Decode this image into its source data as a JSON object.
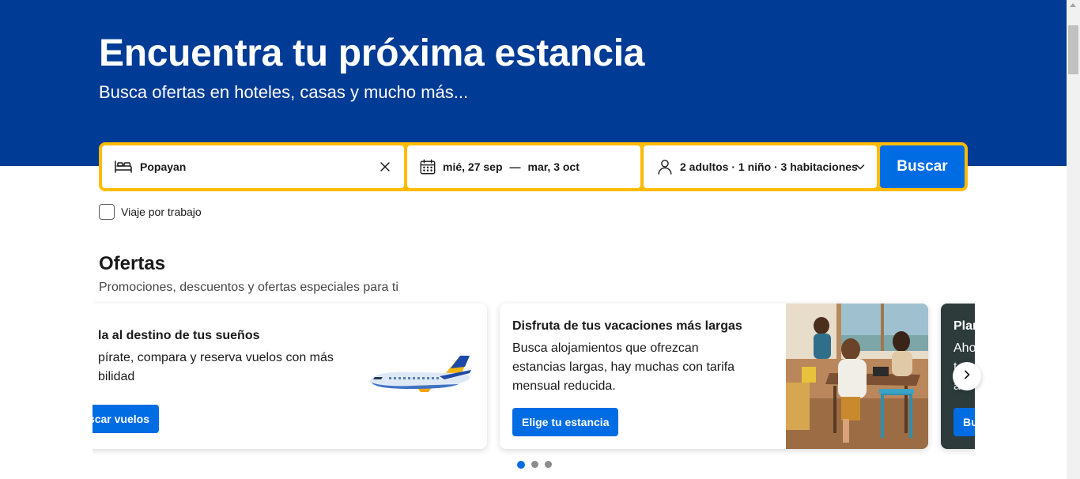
{
  "hero": {
    "title": "Encuentra tu próxima estancia",
    "subtitle": "Busca ofertas en hoteles, casas y mucho más..."
  },
  "search": {
    "destination": "Popayan",
    "check_in": "mié, 27 sep",
    "separator": "—",
    "check_out": "mar, 3 oct",
    "guests": "2 adultos · 1 niño · 3 habitaciones",
    "button_label": "Buscar",
    "icons": {
      "destination": "bed-icon",
      "clear": "close-icon",
      "dates": "calendar-icon",
      "guests": "person-icon",
      "guests_toggle": "chevron-down-icon"
    }
  },
  "work_trip": {
    "label": "Viaje por trabajo",
    "checked": false
  },
  "offers": {
    "title": "Ofertas",
    "subtitle": "Promociones, descuentos y ofertas especiales para ti",
    "cards": [
      {
        "title": "la al destino de tus sueños",
        "desc_line1": "pírate, compara y reserva vuelos con más",
        "desc_line2": "bilidad",
        "button": "scar vuelos",
        "image": "airplane-illustration"
      },
      {
        "title": "Disfruta de tus vacaciones más largas",
        "desc_line1": "Busca alojamientos que ofrezcan",
        "desc_line2": "estancias largas, hay muchas con tarifa",
        "desc_line3": "mensual reducida.",
        "button": "Elige tu estancia",
        "image": "family-dining-photo"
      },
      {
        "title": "Plan",
        "desc_line1": "Aho",
        "desc_line2": "t",
        "desc_line3": "a",
        "button": "Bu"
      }
    ],
    "next_icon": "chevron-right-icon",
    "pagination": {
      "count": 3,
      "active": 1
    }
  },
  "colors": {
    "hero_bg": "#003b95",
    "search_border": "#febb02",
    "primary_button": "#006ce4"
  }
}
